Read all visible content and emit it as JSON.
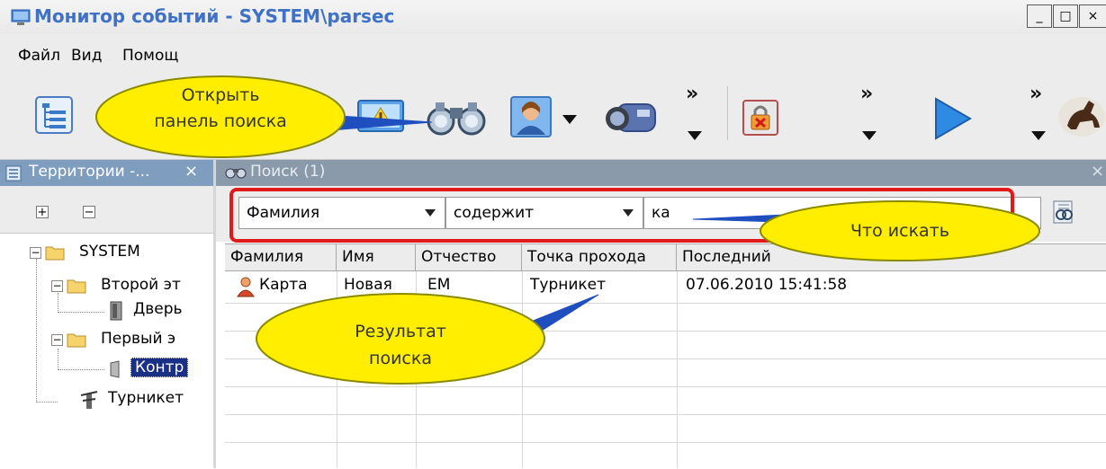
{
  "window": {
    "title": "Монитор событий - SYSTEM\\parsec",
    "minimize_label": "_",
    "maximize_label": "□",
    "close_label": "×"
  },
  "menu": [
    "Файл",
    "Вид",
    "Помощ"
  ],
  "toolbar": {
    "chevron": "»",
    "icons": [
      "tree-view-icon",
      "view-icon",
      "alarm-monitor-icon",
      "binoculars-icon",
      "person-icon",
      "camera-icon",
      "access-lock-icon",
      "play-icon",
      "horse-icon"
    ]
  },
  "left_panel": {
    "title": "Территории -...",
    "close": "×",
    "expand_all": "+",
    "collapse_all": "−",
    "tree": [
      {
        "label": "SYSTEM"
      },
      {
        "label": "Второй эт"
      },
      {
        "label": "Дверь"
      },
      {
        "label": "Первый э"
      },
      {
        "label": "Контр"
      },
      {
        "label": "Турникет"
      }
    ]
  },
  "search_panel": {
    "title": "Поиск (1)",
    "close": "×",
    "field_select": "Фамилия",
    "condition_select": "содержит",
    "query": "ка",
    "columns": [
      "Фамилия",
      "Имя",
      "Отчество",
      "Точка прохода",
      "Последний"
    ],
    "rows": [
      {
        "last_name": "Карта",
        "first_name": "Новая",
        "patronymic": "ЕМ",
        "access_point": "Турникет",
        "last_seen": "07.06.2010 15:41:58"
      }
    ]
  },
  "callouts": {
    "open_search_line1": "Открыть",
    "open_search_line2": "панель поиска",
    "what_to_search": "Что искать",
    "result_line1": "Результат",
    "result_line2": "поиска"
  },
  "colors": {
    "title_text": "#3f72c6",
    "highlight_red": "#e01a1a",
    "callout_fill": "#ffee00",
    "tree_selection": "#1a2f86"
  }
}
